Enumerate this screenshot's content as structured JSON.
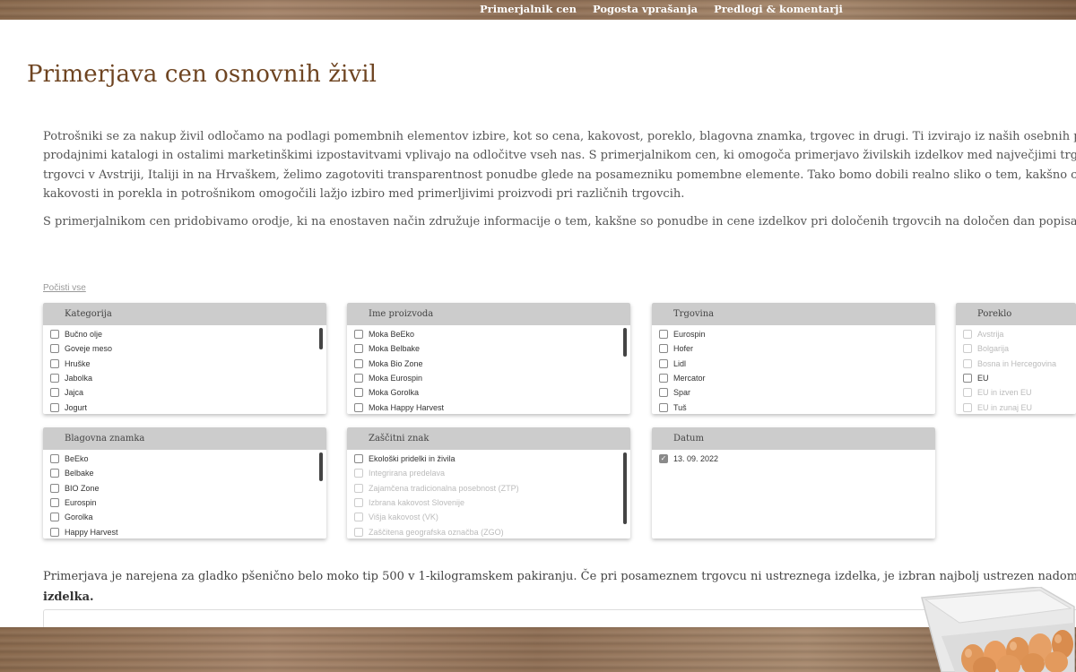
{
  "nav": {
    "items": [
      "Primerjalnik cen",
      "Pogosta vprašanja",
      "Predlogi & komentarji"
    ]
  },
  "page": {
    "title": "Primerjava cen osnovnih živil",
    "intro_lines": [
      "Potrošniki se za nakup živil odločamo na podlagi pomembnih elementov izbire, kot so cena, kakovost, poreklo, blagovna znamka, trgovec in drugi. Ti izvirajo iz naših osebnih prefer",
      "prodajnimi katalogi in ostalimi marketinškimi izpostavitvami vplivajo na odločitve vseh nas. S primerjalnikom cen, ki omogoča primerjavo živilskih izdelkov med največjimi trgov",
      "trgovci v Avstriji, Italiji in na Hrvaškem, želimo zagotoviti transparentnost ponudbe glede na posamezniku pomembne elemente. Tako bomo dobili realno sliko o tem, kakšno ceno i",
      "kakovosti in porekla in potrošnikom omogočili lažjo izbiro med primerljivimi proizvodi pri različnih trgovcih."
    ],
    "intro_p2": "S primerjalnikom cen pridobivamo orodje, ki na enostaven način združuje informacije o tem, kakšne so ponudbe in cene izdelkov pri določenih trgovcih na določen dan popisa v Slo",
    "reset_label": "Počisti vse",
    "note_line1": "Primerjava je narejena za gladko pšenično belo moko tip 500 v 1-kilogramskem pakiranju. Če pri posameznem trgovcu ni ustreznega izdelka, je izbran najbolj ustrezen nadomestek.",
    "note_line2": "izdelka."
  },
  "filters": {
    "kategorija": {
      "title": "Kategorija",
      "options": [
        "Bučno olje",
        "Goveje meso",
        "Hruške",
        "Jabolka",
        "Jajca",
        "Jogurt"
      ]
    },
    "ime": {
      "title": "Ime proizvoda",
      "options": [
        "Moka BeEko",
        "Moka Belbake",
        "Moka Bio Zone",
        "Moka Eurospin",
        "Moka Gorolka",
        "Moka Happy Harvest"
      ]
    },
    "trgovina": {
      "title": "Trgovina",
      "options": [
        "Eurospin",
        "Hofer",
        "Lidl",
        "Mercator",
        "Spar",
        "Tuš"
      ]
    },
    "poreklo": {
      "title": "Poreklo",
      "options": [
        "Avstrija",
        "Bolgarija",
        "Bosna in Hercegovina",
        "EU",
        "EU in izven EU",
        "EU in zunaj EU"
      ]
    },
    "znamka": {
      "title": "Blagovna znamka",
      "options": [
        "BeEko",
        "Belbake",
        "BIO Zone",
        "Eurospin",
        "Gorolka",
        "Happy Harvest"
      ]
    },
    "znak": {
      "title": "Zaščitni znak",
      "options": [
        "Ekološki pridelki in živila",
        "Integrirana predelava",
        "Zajamčena tradicionalna posebnost (ZTP)",
        "Izbrana kakovost Slovenije",
        "Višja kakovost (VK)",
        "Zaščitena geografska označba (ZGO)"
      ]
    },
    "datum": {
      "title": "Datum",
      "options": [
        "13. 09. 2022"
      ]
    }
  },
  "colors": {
    "title": "#6e4421",
    "header_bg": "#cccccc",
    "wood": "#9a7a5e"
  },
  "icons": {
    "checkmark": "✓"
  }
}
